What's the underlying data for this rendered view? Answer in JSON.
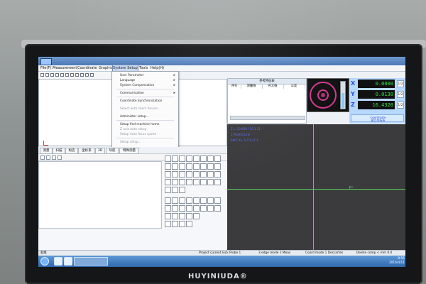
{
  "menu": {
    "items": [
      "File(F)",
      "Measurement",
      "Coordinate",
      "Graphic",
      "System Setup",
      "Tools",
      "Help(H)"
    ]
  },
  "dropdown": {
    "items": [
      "User Parameter",
      "Language",
      "System Compensation",
      "Communication",
      "Coordinate Synchronization",
      "Select auto zoom device...",
      "Administor setup...",
      "Setup find machine home",
      "Z axis auto setup",
      "Setup Auto focus speed",
      "Setup setup..."
    ]
  },
  "tabs": [
    "测量",
    "扫描",
    "构造",
    "坐标系",
    "3D",
    "导航",
    "特殊测量"
  ],
  "table": {
    "header": "参考特征表",
    "columns": [
      "序号",
      "测量值",
      "名义值",
      "公差"
    ]
  },
  "coordinates": {
    "x_label": "X",
    "y_label": "Y",
    "z_label": "Z",
    "x_value": "0.0000",
    "y_value": "0.0130",
    "z_value": "16.4320",
    "x_unit": "1/2",
    "y_unit": "1/2",
    "z_unit": "1/2",
    "footer_top": "Coordinate",
    "footer_bottom": "建立坐标系"
  },
  "canvas_labels": {
    "line1": "Z = 10.000 / 10.1 21",
    "line2": "1 Point/0 Line",
    "line3": "Ref.1 X= 5.0 Y=5.1"
  },
  "status": {
    "left": "就绪",
    "middle1": "Project current lock Probe 1",
    "middle2": "3 edge mode 1 Meas",
    "middle3": "Coord mode 1 Descartes",
    "right": "Delete comp < mm 0.0"
  },
  "taskbar": {
    "clock_time": "9:55",
    "clock_date": "2016/4/11"
  },
  "brand": {
    "name": "HUYINIUDA®"
  },
  "colors": {
    "accent": "#4d78b5",
    "coord_bg": "#b8d9ff",
    "dark_view": "#3b3b3e",
    "crosshair": "#58d05b",
    "highlight_ring": "#d4388f"
  }
}
